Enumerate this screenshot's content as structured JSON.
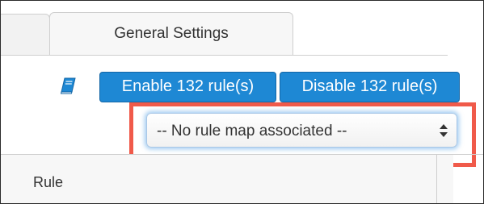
{
  "tabs": [
    {
      "label": ""
    },
    {
      "label": "General Settings",
      "active": true
    }
  ],
  "actions": {
    "enable_label": "Enable 132 rule(s)",
    "disable_label": "Disable 132 rule(s)",
    "help_icon": "book-icon"
  },
  "rule_map": {
    "selected": "-- No rule map associated --"
  },
  "table": {
    "columns": [
      "Rule"
    ]
  },
  "colors": {
    "primary_button": "#1e88d4",
    "highlight": "#f05a4a"
  }
}
